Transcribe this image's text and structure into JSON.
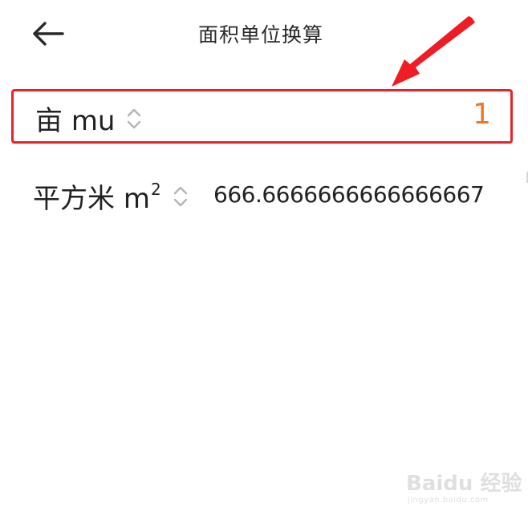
{
  "header": {
    "back_icon": "arrow-left-icon",
    "title": "面积单位换算"
  },
  "rows": [
    {
      "unit_name": "亩",
      "unit_symbol": "mu",
      "unit_superscript": "",
      "selector_icon": "chevron-up-down-icon",
      "value": "1",
      "highlighted": true
    },
    {
      "unit_name": "平方米",
      "unit_symbol": "m",
      "unit_superscript": "2",
      "selector_icon": "chevron-up-down-icon",
      "value": "666.6666666666666667",
      "highlighted": false
    }
  ],
  "annotation": {
    "arrow_icon": "red-arrow-icon",
    "highlight_color": "#e8232a"
  },
  "watermark": {
    "brand": "Baidu 经验",
    "url": "jingyan.baidu.com"
  },
  "colors": {
    "accent_value": "#e87a2c",
    "text_primary": "#222222",
    "chevron": "#b5b5b5"
  }
}
